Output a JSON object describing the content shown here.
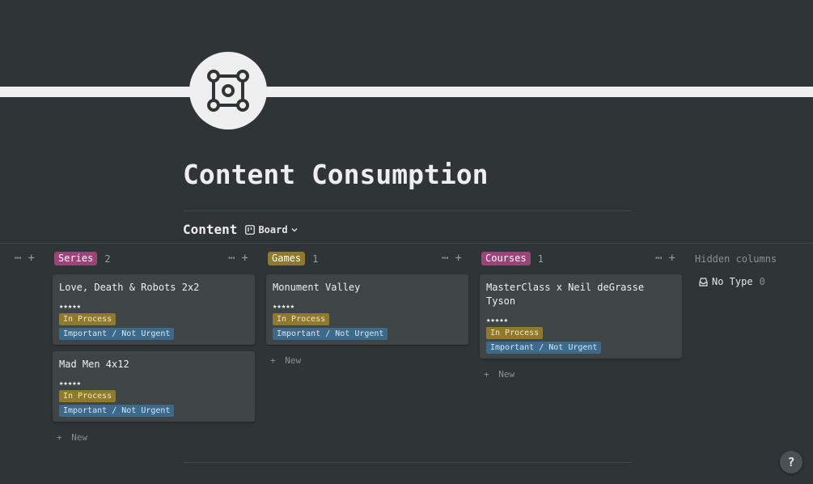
{
  "page": {
    "title": "Content Consumption",
    "icon": "four-points-square-icon"
  },
  "database": {
    "title": "Content",
    "view_label": "Board"
  },
  "columns": [
    {
      "name": "Series",
      "count": "2",
      "color": "#a0427a",
      "cards": [
        {
          "title": "Love, Death & Robots 2x2",
          "rating": "★★★★★",
          "status": "In Process",
          "priority": "Important / Not Urgent"
        },
        {
          "title": "Mad Men 4x12",
          "rating": "★★★★★",
          "status": "In Process",
          "priority": "Important / Not Urgent"
        }
      ],
      "new_label": "New"
    },
    {
      "name": "Games",
      "count": "1",
      "color": "#8f7a2c",
      "cards": [
        {
          "title": "Monument Valley",
          "rating": "★★★★★",
          "status": "In Process",
          "priority": "Important / Not Urgent"
        }
      ],
      "new_label": "New"
    },
    {
      "name": "Courses",
      "count": "1",
      "color": "#a0427a",
      "cards": [
        {
          "title": "MasterClass x Neil deGrasse Tyson",
          "rating": "★★★★★",
          "status": "In Process",
          "priority": "Important / Not Urgent"
        }
      ],
      "new_label": "New"
    }
  ],
  "column_actions": {
    "more": "⋯",
    "add": "+"
  },
  "hidden": {
    "label": "Hidden columns",
    "items": [
      {
        "name": "No Type",
        "count": "0",
        "icon": "inbox-icon"
      }
    ]
  },
  "help": {
    "label": "?"
  },
  "colors": {
    "background": "#2f3437",
    "card": "#3f4447",
    "status": "#8f7a2c",
    "priority": "#3d6a8a"
  }
}
